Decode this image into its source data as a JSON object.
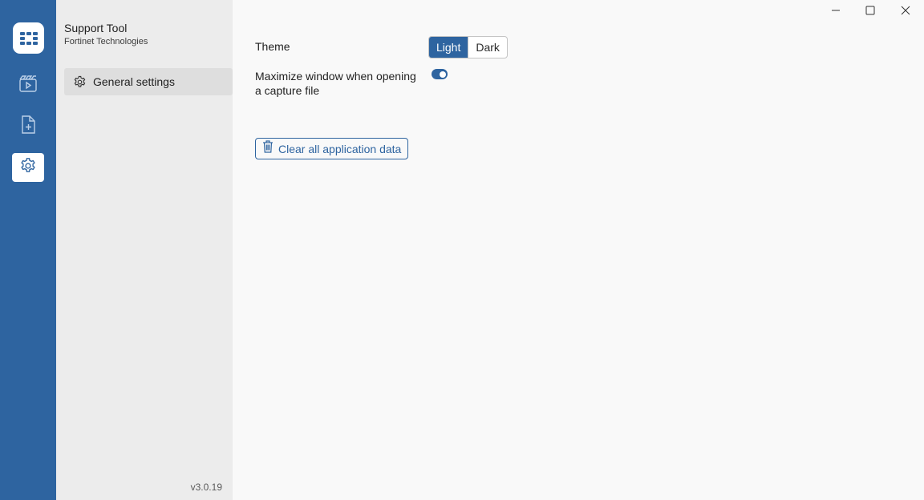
{
  "app": {
    "title": "Support Tool",
    "company": "Fortinet Technologies",
    "version": "v3.0.19"
  },
  "rail": {
    "items": [
      {
        "icon": "fortinet-logo-icon"
      },
      {
        "icon": "video-capture-icon"
      },
      {
        "icon": "file-add-icon"
      },
      {
        "icon": "gear-icon",
        "active": true
      }
    ]
  },
  "sidebar": {
    "items": [
      {
        "label": "General settings",
        "icon": "gear-icon",
        "selected": true
      }
    ]
  },
  "settings": {
    "theme_label": "Theme",
    "theme_options": [
      "Light",
      "Dark"
    ],
    "theme_selected": "Light",
    "maximize_label": "Maximize window when opening a capture file",
    "maximize_enabled": true,
    "clear_button_label": "Clear all application data"
  },
  "colors": {
    "accent": "#2e64a0",
    "rail_bg": "#2e64a0",
    "sidebar_bg": "#ececec",
    "content_bg": "#f9f9f9"
  }
}
